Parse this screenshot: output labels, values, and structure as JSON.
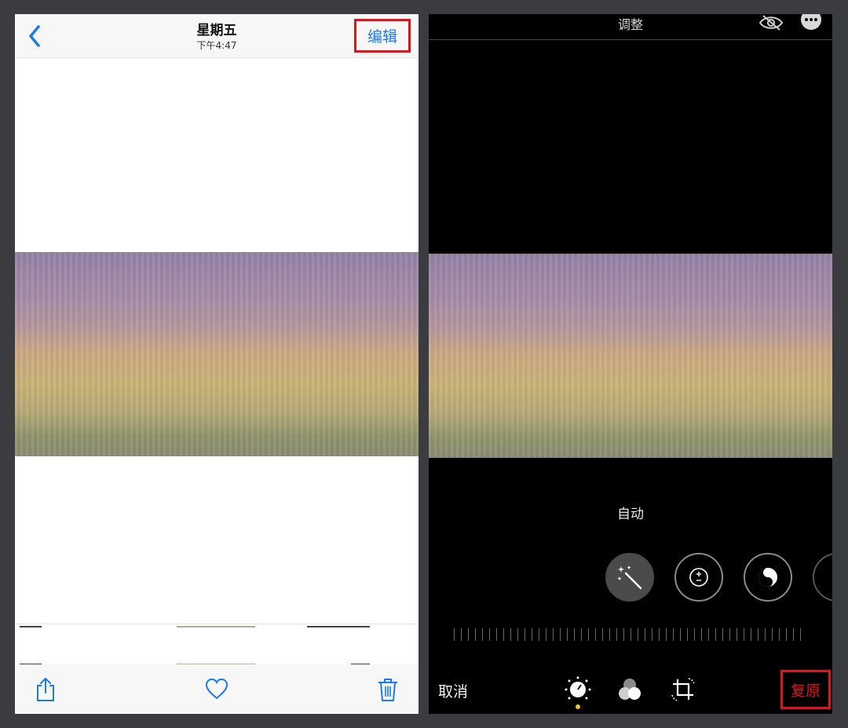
{
  "left": {
    "nav": {
      "title": "星期五",
      "subtitle": "下午4:47",
      "edit_label": "编辑"
    },
    "toolbar": {
      "icons": [
        "share-icon",
        "heart-icon",
        "trash-icon"
      ]
    }
  },
  "right": {
    "header": {
      "title": "调整",
      "icons": [
        "hide-eye-icon",
        "more-icon"
      ]
    },
    "mode_label": "自动",
    "adjust_buttons": [
      "magic-wand-icon",
      "exposure-icon",
      "contrast-icon"
    ],
    "footer": {
      "cancel_label": "取消",
      "restore_label": "复原",
      "tabs": [
        "adjust-dial-icon",
        "filters-icon",
        "crop-rotate-icon"
      ]
    }
  },
  "colors": {
    "accent": "#1a7cf0",
    "highlight_box": "#e0151b",
    "active_dot": "#f5c518"
  }
}
